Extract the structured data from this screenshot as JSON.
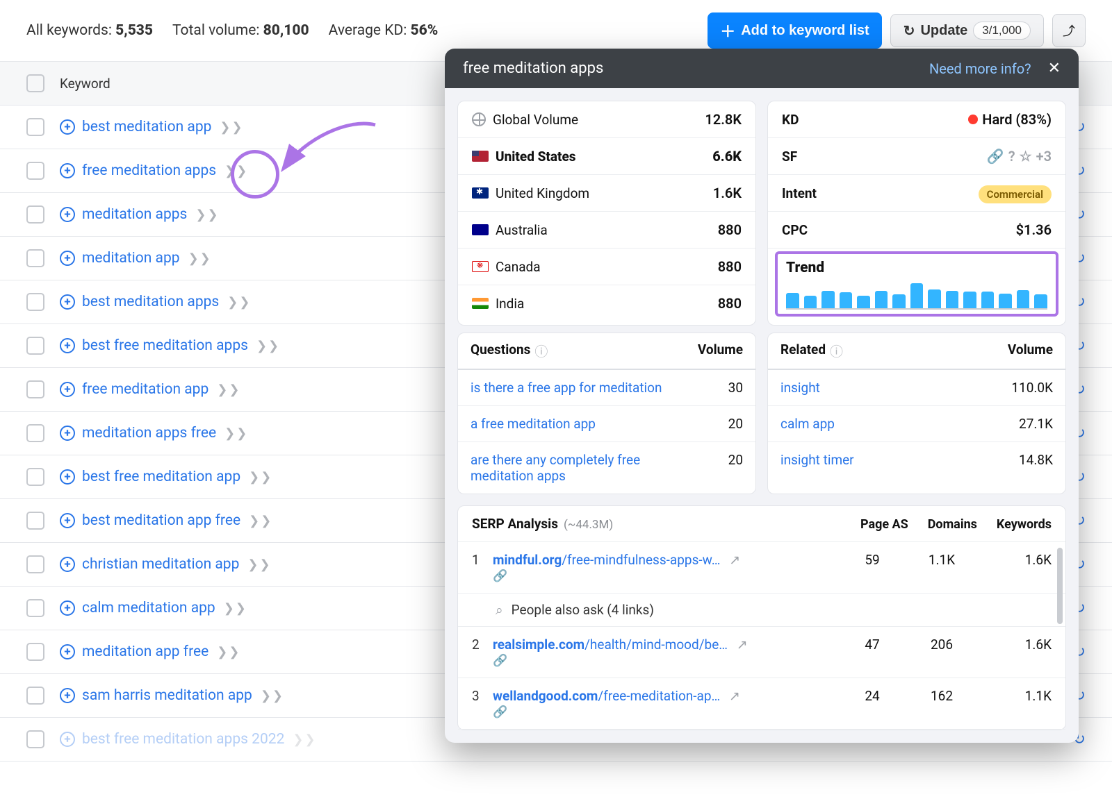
{
  "summary": {
    "all_keywords_label": "All keywords:",
    "all_keywords_value": "5,535",
    "total_volume_label": "Total volume:",
    "total_volume_value": "80,100",
    "avg_kd_label": "Average KD:",
    "avg_kd_value": "56%"
  },
  "actions": {
    "add_label": "Add to keyword list",
    "update_label": "Update",
    "update_count": "3/1,000"
  },
  "table": {
    "header": "Keyword",
    "rows": [
      {
        "kw": "best meditation app"
      },
      {
        "kw": "free meditation apps"
      },
      {
        "kw": "meditation apps"
      },
      {
        "kw": "meditation app"
      },
      {
        "kw": "best meditation apps"
      },
      {
        "kw": "best free meditation apps"
      },
      {
        "kw": "free meditation app"
      },
      {
        "kw": "meditation apps free"
      },
      {
        "kw": "best free meditation app"
      },
      {
        "kw": "best meditation app free"
      },
      {
        "kw": "christian meditation app"
      },
      {
        "kw": "calm meditation app"
      },
      {
        "kw": "meditation app free"
      },
      {
        "kw": "sam harris meditation app"
      },
      {
        "kw": "best free meditation apps 2022"
      }
    ]
  },
  "panel": {
    "title": "free meditation apps",
    "info_link": "Need more info?",
    "volumes": {
      "global_label": "Global Volume",
      "global_value": "12.8K",
      "countries": [
        {
          "name": "United States",
          "value": "6.6K",
          "flag": "us"
        },
        {
          "name": "United Kingdom",
          "value": "1.6K",
          "flag": "uk"
        },
        {
          "name": "Australia",
          "value": "880",
          "flag": "au"
        },
        {
          "name": "Canada",
          "value": "880",
          "flag": "ca"
        },
        {
          "name": "India",
          "value": "880",
          "flag": "in"
        }
      ]
    },
    "metrics": {
      "kd_label": "KD",
      "kd_value": "Hard (83%)",
      "sf_label": "SF",
      "sf_value": "+3",
      "intent_label": "Intent",
      "intent_value": "Commercial",
      "cpc_label": "CPC",
      "cpc_value": "$1.36",
      "trend_label": "Trend"
    },
    "questions": {
      "header": "Questions",
      "vol_header": "Volume",
      "items": [
        {
          "q": "is there a free app for meditation",
          "v": "30"
        },
        {
          "q": "a free meditation app",
          "v": "20"
        },
        {
          "q": "are there any completely free meditation apps",
          "v": "20"
        }
      ]
    },
    "related": {
      "header": "Related",
      "vol_header": "Volume",
      "items": [
        {
          "q": "insight",
          "v": "110.0K"
        },
        {
          "q": "calm app",
          "v": "27.1K"
        },
        {
          "q": "insight timer",
          "v": "14.8K"
        }
      ]
    },
    "serp": {
      "header": "SERP Analysis",
      "count": "(~44.3M)",
      "col1": "Page AS",
      "col2": "Domains",
      "col3": "Keywords",
      "paa_label": "People also ask (4 links)",
      "rows": [
        {
          "n": "1",
          "domain": "mindful.org",
          "path": "/free-mindfulness-apps-w…",
          "as": "59",
          "dom": "1.1K",
          "kw": "1.6K"
        },
        {
          "n": "2",
          "domain": "realsimple.com",
          "path": "/health/mind-mood/be…",
          "as": "47",
          "dom": "206",
          "kw": "1.6K"
        },
        {
          "n": "3",
          "domain": "wellandgood.com",
          "path": "/free-meditation-ap…",
          "as": "24",
          "dom": "162",
          "kw": "1.1K"
        }
      ]
    }
  },
  "chart_data": {
    "type": "bar",
    "title": "Trend",
    "values": [
      60,
      50,
      70,
      65,
      50,
      70,
      55,
      100,
      75,
      70,
      68,
      66,
      58,
      72,
      55
    ],
    "ylim": [
      0,
      120
    ]
  }
}
